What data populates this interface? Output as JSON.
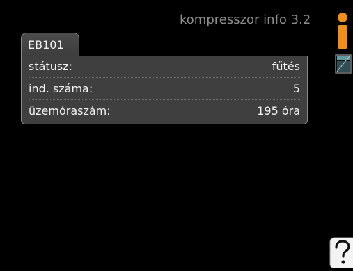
{
  "header": {
    "title": "kompresszor info 3.2"
  },
  "tab": {
    "label": "EB101"
  },
  "rows": [
    {
      "label": "státusz:",
      "value": "fűtés"
    },
    {
      "label": "ind. száma:",
      "value": "5"
    },
    {
      "label": "üzemóraszám:",
      "value": "195 óra"
    }
  ],
  "icons": {
    "top_right": "info-icon",
    "middle_right": "manual-icon",
    "bottom_right": "help-icon"
  },
  "colors": {
    "accent_orange": "#f28f1b",
    "panel_bg": "#3f3f3f",
    "title_gray": "#8c8c8c"
  }
}
